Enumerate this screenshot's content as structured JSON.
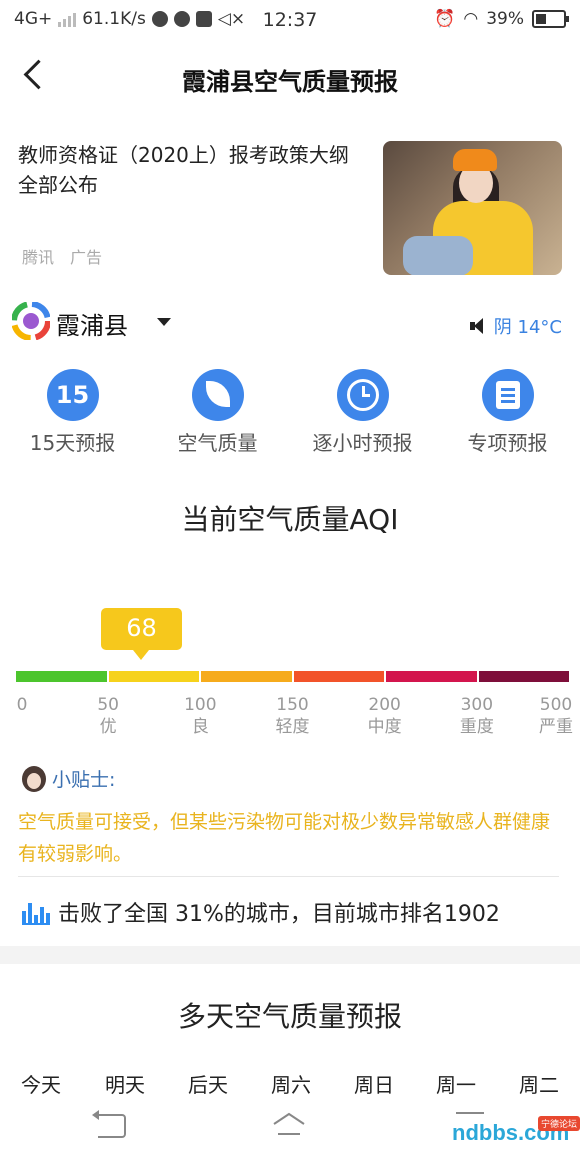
{
  "status": {
    "network": "4G+",
    "speed": "61.1K/s",
    "time": "12:37",
    "battery": "39%"
  },
  "header": {
    "title": "霞浦县空气质量预报"
  },
  "ad": {
    "text": "教师资格证（2020上）报考政策大纲全部公布",
    "source": "腾讯",
    "tag": "广告"
  },
  "location": {
    "city": "霞浦县",
    "weather": "阴 14°C"
  },
  "menu": [
    {
      "label": "15天预报",
      "icon": "calendar-15-icon",
      "glyph": "15"
    },
    {
      "label": "空气质量",
      "icon": "leaf-icon"
    },
    {
      "label": "逐小时预报",
      "icon": "clock-icon"
    },
    {
      "label": "专项预报",
      "icon": "clipboard-icon"
    }
  ],
  "aqi": {
    "title": "当前空气质量AQI",
    "value": "68",
    "scale": [
      {
        "num": "0",
        "level": ""
      },
      {
        "num": "50",
        "level": "优"
      },
      {
        "num": "100",
        "level": "良"
      },
      {
        "num": "150",
        "level": "轻度"
      },
      {
        "num": "200",
        "level": "中度"
      },
      {
        "num": "300",
        "level": "重度"
      },
      {
        "num": "500",
        "level": "严重"
      }
    ],
    "colors": [
      "#4cc52d",
      "#f6d21c",
      "#f6ab1c",
      "#f2532a",
      "#d3154d",
      "#7e0e3a"
    ]
  },
  "tip": {
    "title": "小贴士:",
    "text": "空气质量可接受，但某些污染物可能对极少数异常敏感人群健康有较弱影响。"
  },
  "rank": {
    "text": "击败了全国 31%的城市，目前城市排名1902"
  },
  "forecast": {
    "title": "多天空气质量预报",
    "days": [
      "今天",
      "明天",
      "后天",
      "周六",
      "周日",
      "周一",
      "周二"
    ]
  },
  "watermark": {
    "text": "ndbbs.com",
    "tag": "宁德论坛"
  }
}
